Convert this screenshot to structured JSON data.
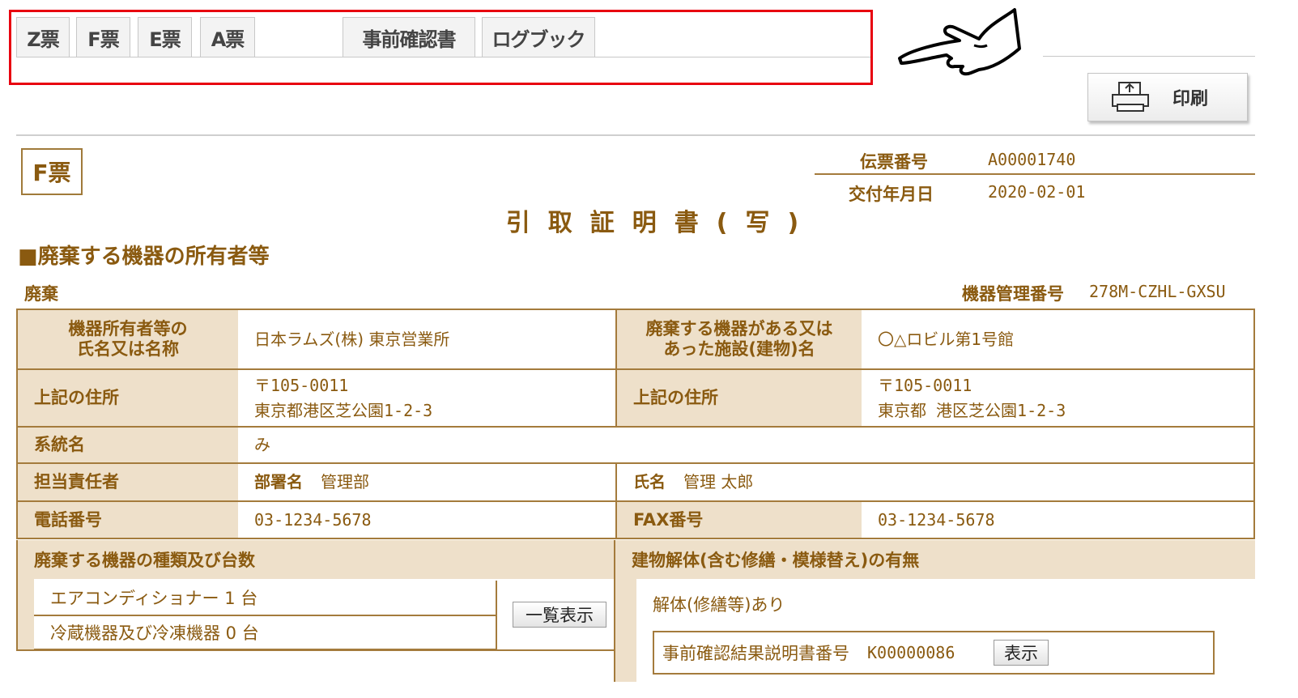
{
  "tabs": [
    {
      "label": "Z票"
    },
    {
      "label": "F票"
    },
    {
      "label": "E票"
    },
    {
      "label": "A票"
    },
    {
      "label": "事前確認書"
    },
    {
      "label": "ログブック"
    }
  ],
  "print_button": {
    "label": "印刷",
    "icon": "printer-icon"
  },
  "pointer_icon": "pointing-hand-icon",
  "form_badge": "F票",
  "meta": {
    "slip_no_label": "伝票番号",
    "slip_no_value": "A00001740",
    "issue_date_label": "交付年月日",
    "issue_date_value": "2020-02-01"
  },
  "document_title": "引取証明書(写)",
  "section_title": "■廃棄する機器の所有者等",
  "disposal_label": "廃棄",
  "equipment_no_label": "機器管理番号",
  "equipment_no_value": "278M-CZHL-GXSU",
  "owner": {
    "name_label_1": "機器所有者等の",
    "name_label_2": "氏名又は名称",
    "name_value": "日本ラムズ(株) 東京営業所",
    "facility_label_1": "廃棄する機器がある又は",
    "facility_label_2": "あった施設(建物)名",
    "facility_value": "〇△ロビル第1号館",
    "address_label": "上記の住所",
    "address_postal": "〒105-0011",
    "address_line": "東京都港区芝公園1-2-3",
    "facility_address_label": "上記の住所",
    "facility_postal": "〒105-0011",
    "facility_line": "東京都 港区芝公園1-2-3",
    "system_label": "系統名",
    "system_value": "み",
    "manager_label": "担当責任者",
    "dept_label": "部署名",
    "dept_value": "管理部",
    "person_label": "氏名",
    "person_value": "管理 太郎",
    "phone_label": "電話番号",
    "phone_value": "03-1234-5678",
    "fax_label": "FAX番号",
    "fax_value": "03-1234-5678"
  },
  "equipment_types": {
    "label": "廃棄する機器の種類及び台数",
    "items": [
      "エアコンディショナー 1 台",
      "冷蔵機器及び冷凍機器 0 台"
    ],
    "list_button": "一覧表示"
  },
  "demolition": {
    "label": "建物解体(含む修繕・模様替え)の有無",
    "status": "解体(修繕等)あり",
    "doc_label": "事前確認結果説明書番号",
    "doc_value": "K00000086",
    "show_button": "表示"
  },
  "colors": {
    "highlight": "#e8000f",
    "brown_text": "#8a5a10",
    "header_bg": "#eee0ca",
    "border": "#a47b3c"
  }
}
